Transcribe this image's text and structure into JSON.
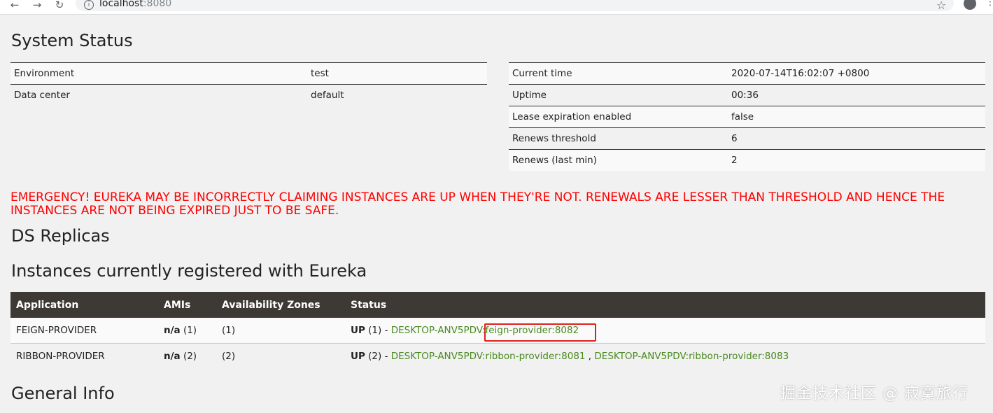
{
  "browser": {
    "back_icon": "←",
    "forward_icon": "→",
    "reload_icon": "↻",
    "url_host": "localhost",
    "url_port": ":8080",
    "star_icon": "☆",
    "menu_icon": "⋮"
  },
  "system_status": {
    "title": "System Status",
    "left_rows": [
      {
        "label": "Environment",
        "value": "test"
      },
      {
        "label": "Data center",
        "value": "default"
      }
    ],
    "right_rows": [
      {
        "label": "Current time",
        "value": "2020-07-14T16:02:07 +0800"
      },
      {
        "label": "Uptime",
        "value": "00:36"
      },
      {
        "label": "Lease expiration enabled",
        "value": "false"
      },
      {
        "label": "Renews threshold",
        "value": "6"
      },
      {
        "label": "Renews (last min)",
        "value": "2"
      }
    ]
  },
  "emergency": "EMERGENCY! EUREKA MAY BE INCORRECTLY CLAIMING INSTANCES ARE UP WHEN THEY'RE NOT. RENEWALS ARE LESSER THAN THRESHOLD AND HENCE THE INSTANCES ARE NOT BEING EXPIRED JUST TO BE SAFE.",
  "ds_replicas": {
    "title": "DS Replicas"
  },
  "instances": {
    "title": "Instances currently registered with Eureka",
    "headers": [
      "Application",
      "AMIs",
      "Availability Zones",
      "Status"
    ],
    "rows": [
      {
        "application": "FEIGN-PROVIDER",
        "amis_bold": "n/a",
        "amis_count": " (1)",
        "zones": "(1)",
        "status_bold": "UP",
        "status_prefix": " (1) - ",
        "links": [
          "DESKTOP-ANV5PDV:feign-provider:8082"
        ]
      },
      {
        "application": "RIBBON-PROVIDER",
        "amis_bold": "n/a",
        "amis_count": " (2)",
        "zones": "(2)",
        "status_bold": "UP",
        "status_prefix": " (2) - ",
        "links": [
          "DESKTOP-ANV5PDV:ribbon-provider:8081",
          "DESKTOP-ANV5PDV:ribbon-provider:8083"
        ],
        "link_separator": " , "
      }
    ]
  },
  "general_info": {
    "title": "General Info"
  },
  "watermark": "掘金技术社区 @ 寂寞旅行",
  "colors": {
    "emergency": "#ff0000",
    "link": "#4a8a1f",
    "table_header": "#3d3935",
    "highlight_box": "#e02020"
  }
}
